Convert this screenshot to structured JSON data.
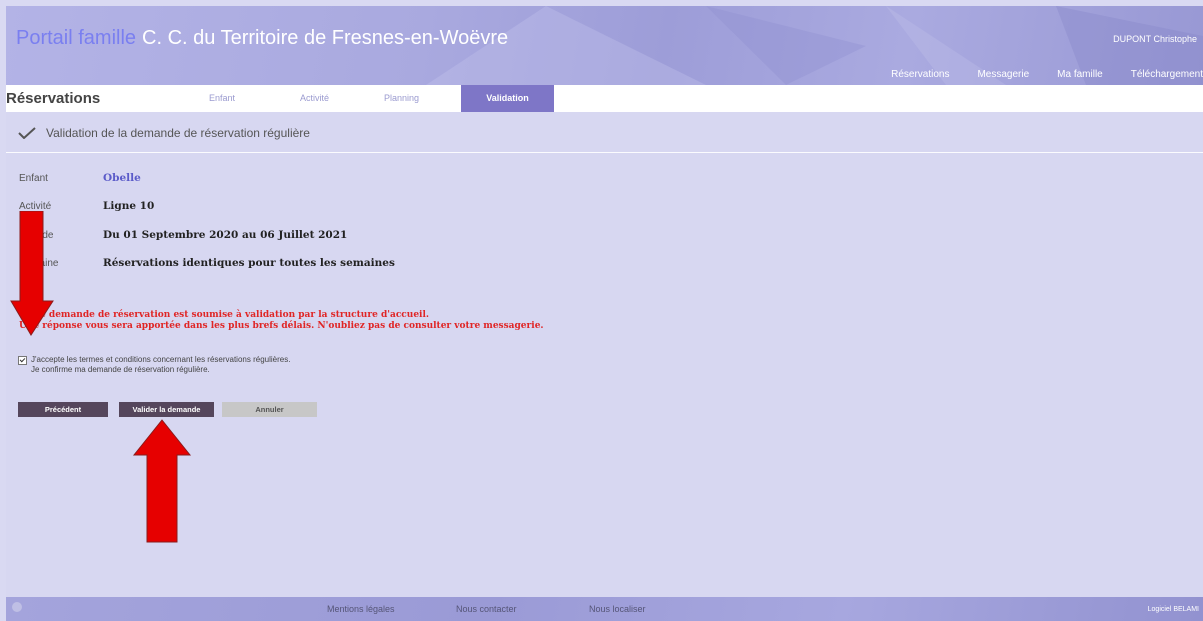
{
  "header": {
    "brand_primary": "Portail famille",
    "brand_secondary": "C. C. du Territoire de Fresnes-en-Woëvre",
    "user_name": "DUPONT Christophe",
    "nav": [
      "Réservations",
      "Messagerie",
      "Ma famille",
      "Téléchargement"
    ]
  },
  "tabbar": {
    "title": "Réservations",
    "tabs": [
      "Enfant",
      "Activité",
      "Planning",
      "Validation"
    ],
    "active_tab": "Validation"
  },
  "main": {
    "section_title": "Validation de la demande de réservation régulière",
    "fields": [
      {
        "label": "Enfant",
        "value": "Obelle"
      },
      {
        "label": "Activité",
        "value": "Ligne 10"
      },
      {
        "label": "Période",
        "value": "Du 01 Septembre 2020 au 06 Juillet 2021"
      },
      {
        "label": "Semaine",
        "value": "Réservations identiques pour toutes les semaines"
      }
    ],
    "warning_lines": [
      "Votre demande de réservation est soumise à validation par la structure d'accueil.",
      "Une réponse vous sera apportée dans les plus brefs délais. N'oubliez pas de consulter votre messagerie."
    ],
    "checkbox": {
      "checked": true,
      "line1": "J'accepte les termes et conditions concernant les réservations régulières.",
      "line2": "Je confirme ma demande de réservation régulière."
    },
    "buttons": {
      "previous": "Précédent",
      "validate": "Valider la demande",
      "cancel": "Annuler"
    }
  },
  "footer": {
    "links": [
      "Mentions légales",
      "Nous contacter",
      "Nous localiser"
    ],
    "credit": "Logiciel BELAMI"
  },
  "colors": {
    "accent": "#7e76c7",
    "warning": "#e02525",
    "button_dark": "#55465c",
    "annotation_arrow": "#e60000"
  }
}
